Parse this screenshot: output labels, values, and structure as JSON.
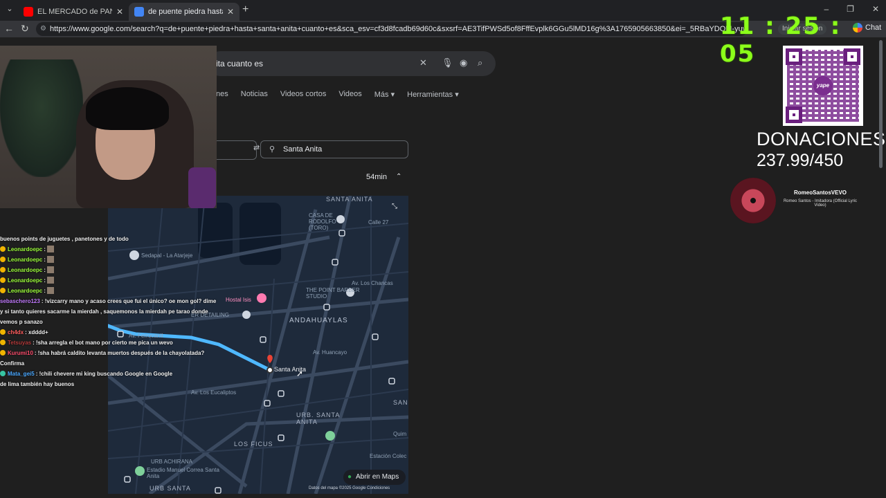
{
  "browser": {
    "tabs": [
      {
        "title": "EL MERCADO de PANETONES NAVIDEÑOS",
        "favicon_color": "#ff0000"
      },
      {
        "title": "de puente piedra hasta santa anita",
        "favicon_color": "#4285f4"
      }
    ],
    "url": "https://www.google.com/search?q=de+puente+piedra+hasta+santa+anita+cuanto+es&sca_esv=cf3d8fcadb69d60c&sxsrf=AE3TifPWSd5of8FffEvplk6GGu5lMD16g%3A1765905663850&ei=_5RBaYDQM-yuwbkP8on34AM&ved=2ahUKEw",
    "signin_label": "Iniciar sesión",
    "chat_label": "Chat"
  },
  "clock": {
    "text": "11 : 25 : 05",
    "color": "#8cff1a"
  },
  "google": {
    "search_text": "ita cuanto es",
    "tabs": [
      "nes",
      "Noticias",
      "Videos cortos",
      "Videos",
      "Más ▾",
      "Herramientas ▾"
    ],
    "directions": {
      "destination": "Santa Anita",
      "duration": "54min"
    },
    "map": {
      "labels": {
        "santa_anita_top": "SANTA ANITA",
        "casa_rodolfo": "CASA DE RODOLFO (TORO)",
        "sedapal": "Sedapal - La Atarjeje",
        "hostal": "Hostal Isis",
        "point": "THE POINT BARBER STUDIO",
        "andahuaylas": "ANDAHUAYLAS",
        "detailing": "ER DETAILING",
        "ferrocarril": "Av. Ferrocarril",
        "huancayo": "Av. Huancayo",
        "eucaliptos": "Av. Los Eucaliptos",
        "chancas": "Av. Los Chancas",
        "urb_santa_anita": "URB. SANTA ANITA",
        "los_ficus": "LOS FICUS",
        "corpac": "LOS FICUS",
        "rodolfo_calle": "Calle 27",
        "estadio": "Estadio Manuel Correa Santa Anita",
        "estacion": "Estación Colec",
        "urb_achirana": "URB ACHIRANA",
        "urb_santa": "URB SANTA",
        "santa_anita_pin": "Santa Anita",
        "san": "SAN",
        "quim": "Quim"
      },
      "open_maps_label": "Abrir en Maps",
      "footer": "Datos del mapa ©2025 Google   Condiciones"
    }
  },
  "chat": [
    {
      "user": "",
      "text": "buenos points de juguetes , panetones y de todo",
      "color": "#ffffff",
      "badge": ""
    },
    {
      "user": "Leonardoepc",
      "text": ":",
      "color": "#9cff3a",
      "badge": "#f0b400",
      "emote": true
    },
    {
      "user": "Leonardoepc",
      "text": ":",
      "color": "#9cff3a",
      "badge": "#f0b400",
      "emote": true
    },
    {
      "user": "Leonardoepc",
      "text": ":",
      "color": "#9cff3a",
      "badge": "#f0b400",
      "emote": true
    },
    {
      "user": "Leonardoepc",
      "text": ":",
      "color": "#9cff3a",
      "badge": "#f0b400",
      "emote": true
    },
    {
      "user": "Leonardoepc",
      "text": ":",
      "color": "#9cff3a",
      "badge": "#f0b400",
      "emote": true
    },
    {
      "user": "sebaschero123",
      "text": ": !vizcarry mano y acaso crees que fui el único? oe mon gol? dime",
      "color": "#c27bff",
      "badge": ""
    },
    {
      "user": "",
      "text": "y si tanto quieres sacarme la mierdah , saquemonos la mierdah pe tarao donde",
      "color": "#ffffff",
      "badge": ""
    },
    {
      "user": "",
      "text": "vemos p sanazo",
      "color": "#ffffff",
      "badge": ""
    },
    {
      "user": "ch4dx",
      "text": ": xdddd+",
      "color": "#ff5d5d",
      "badge": "#f0b400"
    },
    {
      "user": "Tetsuyas",
      "text": ": !sha arregla el bot mano por cierto me pica un wevo",
      "color": "#b23a3a",
      "badge": "#f0b400"
    },
    {
      "user": "Kurumi10",
      "text": ": !sha habrá caldito levanta muertos después de la chayolatada?",
      "color": "#ff4d6d",
      "badge": "#f0b400"
    },
    {
      "user": "",
      "text": "Confirma",
      "color": "#ffffff",
      "badge": ""
    },
    {
      "user": "Mata_gei5",
      "text": ": !chili chevere mi king buscando Google en Google",
      "color": "#4aa8ff",
      "badge": "#37c4a3"
    },
    {
      "user": "",
      "text": "de lima también hay buenos",
      "color": "#ffffff",
      "badge": ""
    }
  ],
  "donations": {
    "title": "DONACIONES",
    "amount": "237.99/450",
    "qr_brand": "yape"
  },
  "now_playing": {
    "artist": "RomeoSantosVEVO",
    "title": "Romeo Santos - Imitadora (Official Lyric Video)"
  }
}
